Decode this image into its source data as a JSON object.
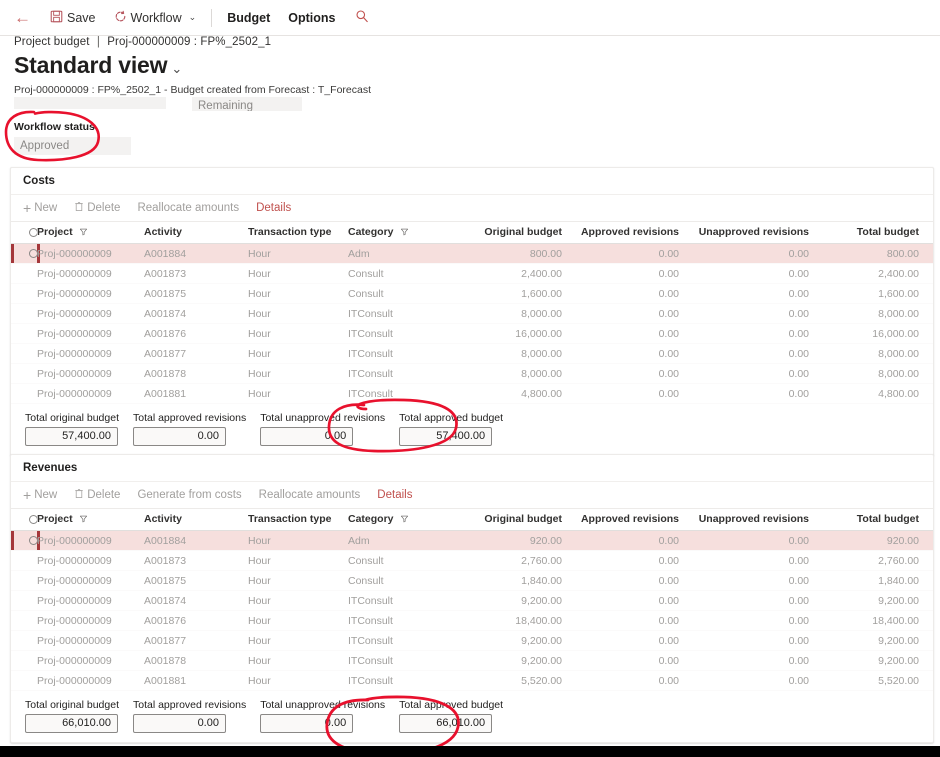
{
  "command_bar": {
    "back_icon": "back-arrow-icon",
    "save_label": "Save",
    "save_icon": "save-floppy-icon",
    "workflow_label": "Workflow",
    "workflow_icon": "workflow-circular-arrow-icon",
    "workflow_chevron": "⌄",
    "budget_label": "Budget",
    "options_label": "Options",
    "search_icon": "search-magnifier-icon",
    "accent_color": "#c0504d"
  },
  "header": {
    "breadcrumb_module": "Project budget",
    "breadcrumb_separator": "|",
    "breadcrumb_record": "Proj-000000009 : FP%_2502_1",
    "page_title": "Standard view",
    "title_chevron": "⌄",
    "subtitle": "Proj-000000009 : FP%_2502_1 - Budget created from Forecast : T_Forecast"
  },
  "header_fields": {
    "remaining_value": "Remaining",
    "workflow_status_label": "Workflow status",
    "workflow_status_value": "Approved"
  },
  "costs": {
    "section_title": "Costs",
    "toolbar": [
      {
        "label": "New",
        "icon": "plus-icon",
        "state": "disabled"
      },
      {
        "label": "Delete",
        "icon": "trash-icon",
        "state": "disabled"
      },
      {
        "label": "Reallocate amounts",
        "icon": "",
        "state": "disabled"
      },
      {
        "label": "Details",
        "icon": "",
        "state": "active"
      }
    ],
    "columns": [
      "Project",
      "Activity",
      "Transaction type",
      "Category",
      "Original budget",
      "Approved revisions",
      "Unapproved revisions",
      "Total budget"
    ],
    "rows": [
      {
        "project": "Proj-000000009",
        "activity": "A001884",
        "transaction_type": "Hour",
        "category": "Adm",
        "original_budget": "800.00",
        "approved_revisions": "0.00",
        "unapproved_revisions": "0.00",
        "total_budget": "800.00",
        "selected": true
      },
      {
        "project": "Proj-000000009",
        "activity": "A001873",
        "transaction_type": "Hour",
        "category": "Consult",
        "original_budget": "2,400.00",
        "approved_revisions": "0.00",
        "unapproved_revisions": "0.00",
        "total_budget": "2,400.00",
        "selected": false
      },
      {
        "project": "Proj-000000009",
        "activity": "A001875",
        "transaction_type": "Hour",
        "category": "Consult",
        "original_budget": "1,600.00",
        "approved_revisions": "0.00",
        "unapproved_revisions": "0.00",
        "total_budget": "1,600.00",
        "selected": false
      },
      {
        "project": "Proj-000000009",
        "activity": "A001874",
        "transaction_type": "Hour",
        "category": "ITConsult",
        "original_budget": "8,000.00",
        "approved_revisions": "0.00",
        "unapproved_revisions": "0.00",
        "total_budget": "8,000.00",
        "selected": false
      },
      {
        "project": "Proj-000000009",
        "activity": "A001876",
        "transaction_type": "Hour",
        "category": "ITConsult",
        "original_budget": "16,000.00",
        "approved_revisions": "0.00",
        "unapproved_revisions": "0.00",
        "total_budget": "16,000.00",
        "selected": false
      },
      {
        "project": "Proj-000000009",
        "activity": "A001877",
        "transaction_type": "Hour",
        "category": "ITConsult",
        "original_budget": "8,000.00",
        "approved_revisions": "0.00",
        "unapproved_revisions": "0.00",
        "total_budget": "8,000.00",
        "selected": false
      },
      {
        "project": "Proj-000000009",
        "activity": "A001878",
        "transaction_type": "Hour",
        "category": "ITConsult",
        "original_budget": "8,000.00",
        "approved_revisions": "0.00",
        "unapproved_revisions": "0.00",
        "total_budget": "8,000.00",
        "selected": false
      },
      {
        "project": "Proj-000000009",
        "activity": "A001881",
        "transaction_type": "Hour",
        "category": "ITConsult",
        "original_budget": "4,800.00",
        "approved_revisions": "0.00",
        "unapproved_revisions": "0.00",
        "total_budget": "4,800.00",
        "selected": false
      }
    ],
    "totals": [
      {
        "label": "Total original budget",
        "value": "57,400.00"
      },
      {
        "label": "Total approved revisions",
        "value": "0.00"
      },
      {
        "label": "Total unapproved revisions",
        "value": "0.00"
      },
      {
        "label": "Total approved budget",
        "value": "57,400.00"
      }
    ]
  },
  "revenues": {
    "section_title": "Revenues",
    "toolbar": [
      {
        "label": "New",
        "icon": "plus-icon",
        "state": "disabled"
      },
      {
        "label": "Delete",
        "icon": "trash-icon",
        "state": "disabled"
      },
      {
        "label": "Generate from costs",
        "icon": "",
        "state": "disabled"
      },
      {
        "label": "Reallocate amounts",
        "icon": "",
        "state": "disabled"
      },
      {
        "label": "Details",
        "icon": "",
        "state": "active"
      }
    ],
    "columns": [
      "Project",
      "Activity",
      "Transaction type",
      "Category",
      "Original budget",
      "Approved revisions",
      "Unapproved revisions",
      "Total budget"
    ],
    "rows": [
      {
        "project": "Proj-000000009",
        "activity": "A001884",
        "transaction_type": "Hour",
        "category": "Adm",
        "original_budget": "920.00",
        "approved_revisions": "0.00",
        "unapproved_revisions": "0.00",
        "total_budget": "920.00",
        "selected": true
      },
      {
        "project": "Proj-000000009",
        "activity": "A001873",
        "transaction_type": "Hour",
        "category": "Consult",
        "original_budget": "2,760.00",
        "approved_revisions": "0.00",
        "unapproved_revisions": "0.00",
        "total_budget": "2,760.00",
        "selected": false
      },
      {
        "project": "Proj-000000009",
        "activity": "A001875",
        "transaction_type": "Hour",
        "category": "Consult",
        "original_budget": "1,840.00",
        "approved_revisions": "0.00",
        "unapproved_revisions": "0.00",
        "total_budget": "1,840.00",
        "selected": false
      },
      {
        "project": "Proj-000000009",
        "activity": "A001874",
        "transaction_type": "Hour",
        "category": "ITConsult",
        "original_budget": "9,200.00",
        "approved_revisions": "0.00",
        "unapproved_revisions": "0.00",
        "total_budget": "9,200.00",
        "selected": false
      },
      {
        "project": "Proj-000000009",
        "activity": "A001876",
        "transaction_type": "Hour",
        "category": "ITConsult",
        "original_budget": "18,400.00",
        "approved_revisions": "0.00",
        "unapproved_revisions": "0.00",
        "total_budget": "18,400.00",
        "selected": false
      },
      {
        "project": "Proj-000000009",
        "activity": "A001877",
        "transaction_type": "Hour",
        "category": "ITConsult",
        "original_budget": "9,200.00",
        "approved_revisions": "0.00",
        "unapproved_revisions": "0.00",
        "total_budget": "9,200.00",
        "selected": false
      },
      {
        "project": "Proj-000000009",
        "activity": "A001878",
        "transaction_type": "Hour",
        "category": "ITConsult",
        "original_budget": "9,200.00",
        "approved_revisions": "0.00",
        "unapproved_revisions": "0.00",
        "total_budget": "9,200.00",
        "selected": false
      },
      {
        "project": "Proj-000000009",
        "activity": "A001881",
        "transaction_type": "Hour",
        "category": "ITConsult",
        "original_budget": "5,520.00",
        "approved_revisions": "0.00",
        "unapproved_revisions": "0.00",
        "total_budget": "5,520.00",
        "selected": false
      }
    ],
    "totals": [
      {
        "label": "Total original budget",
        "value": "66,010.00"
      },
      {
        "label": "Total approved revisions",
        "value": "0.00"
      },
      {
        "label": "Total unapproved revisions",
        "value": "0.00"
      },
      {
        "label": "Total approved budget",
        "value": "66,010.00"
      }
    ]
  },
  "annotations": {
    "color": "#e8112d",
    "marks": [
      {
        "name": "workflow-status-circle",
        "target": "Workflow status / Approved"
      },
      {
        "name": "costs-total-approved-budget-circle",
        "target": "Total approved budget 57,400.00"
      },
      {
        "name": "revenues-total-approved-budget-circle",
        "target": "Total approved budget 66,010.00"
      }
    ]
  }
}
